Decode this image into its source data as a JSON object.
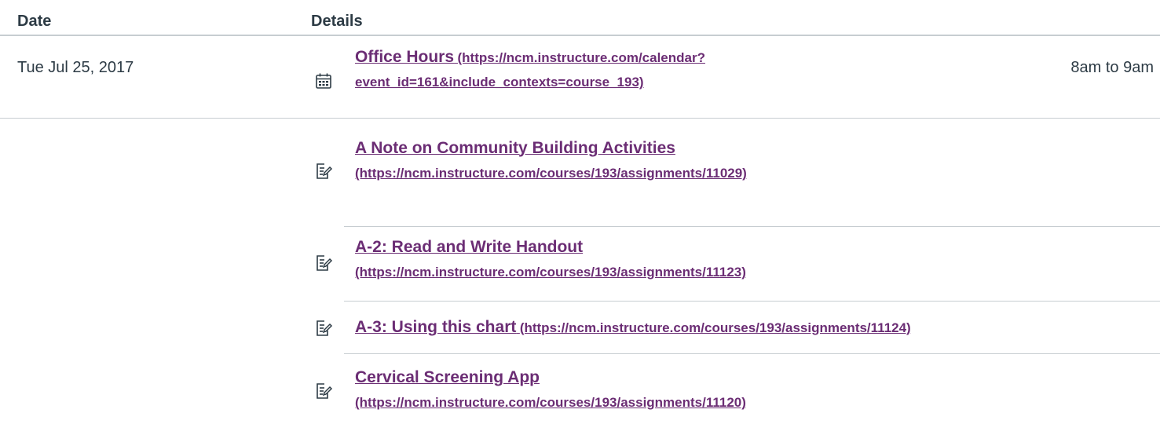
{
  "table": {
    "headers": {
      "date": "Date",
      "details": "Details"
    }
  },
  "rows": [
    {
      "date": "Tue Jul 25, 2017",
      "icon": "calendar-icon",
      "title": "Office Hours",
      "url_line1": "(https://ncm.instructure.com/calendar?",
      "url_line2": "event_id=161&include_contexts=course_193)",
      "time": "8am to 9am"
    }
  ],
  "assignments": [
    {
      "icon": "assignment-icon",
      "title": "A Note on Community Building Activities",
      "url": "(https://ncm.instructure.com/courses/193/assignments/11029)"
    },
    {
      "icon": "assignment-icon",
      "title": "A-2: Read and Write Handout",
      "url": "(https://ncm.instructure.com/courses/193/assignments/11123)"
    },
    {
      "icon": "assignment-icon",
      "title": "A-3: Using this chart",
      "url": "(https://ncm.instructure.com/courses/193/assignments/11124)"
    },
    {
      "icon": "assignment-icon",
      "title": "Cervical Screening App",
      "url": "(https://ncm.instructure.com/courses/193/assignments/11120)"
    }
  ],
  "colors": {
    "link": "#6b2d74",
    "text": "#2d3b45",
    "divider": "#c7cdd1"
  }
}
